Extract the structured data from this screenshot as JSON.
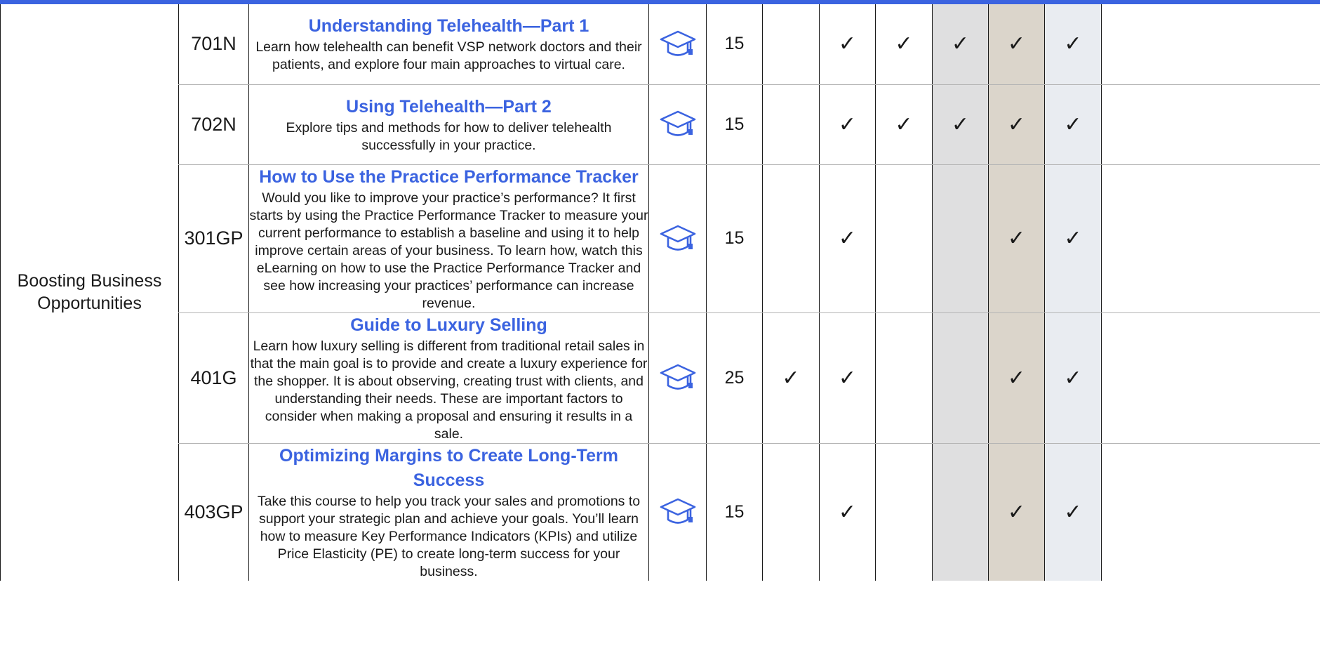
{
  "category": "Boosting Business Opportunities",
  "courses": [
    {
      "code": "701N",
      "title": "Understanding Telehealth—Part 1",
      "description": "Learn how telehealth can benefit VSP network doctors and their patients, and explore four main approaches to virtual care.",
      "icon": "graduation-cap-icon",
      "hours": "15",
      "checks": [
        "",
        "✓",
        "✓",
        "✓",
        "✓",
        "✓"
      ]
    },
    {
      "code": "702N",
      "title": "Using Telehealth—Part 2",
      "description": "Explore tips and methods for how to deliver telehealth successfully in your practice.",
      "icon": "graduation-cap-icon",
      "hours": "15",
      "checks": [
        "",
        "✓",
        "✓",
        "✓",
        "✓",
        "✓"
      ]
    },
    {
      "code": "301GP",
      "title": "How to Use the Practice Performance Tracker",
      "description": "Would you like to improve your practice’s performance? It first starts by using the Practice Performance Tracker to measure your current performance to establish a baseline and using it to help improve certain areas of your business. To learn how, watch this eLearning on how to use the Practice Performance Tracker and see how increasing your practices’ performance can increase revenue.",
      "icon": "graduation-cap-icon",
      "hours": "15",
      "checks": [
        "",
        "✓",
        "",
        "",
        "✓",
        "✓"
      ]
    },
    {
      "code": "401G",
      "title": "Guide to Luxury Selling",
      "description": "Learn how luxury selling is different from traditional retail sales in that the main goal is to provide and create a luxury experience for the shopper. It is about observing, creating trust with clients, and understanding their needs. These are important factors to consider when making a proposal and ensuring it results in a sale.",
      "icon": "graduation-cap-icon",
      "hours": "25",
      "checks": [
        "✓",
        "✓",
        "",
        "",
        "✓",
        "✓"
      ]
    },
    {
      "code": "403GP",
      "title": "Optimizing Margins to Create Long-Term Success",
      "description": "Take this course to help you track your sales and promotions to support your strategic plan and achieve your goals. You’ll learn how to measure Key Performance Indicators (KPIs) and utilize Price Elasticity (PE) to create long-term success for your business.",
      "icon": "graduation-cap-icon",
      "hours": "15",
      "checks": [
        "",
        "✓",
        "",
        "",
        "✓",
        "✓"
      ]
    }
  ],
  "colors": {
    "accent": "#3b63e0",
    "shade_gray": "#dfdfe0",
    "shade_tan": "#dbd5cb",
    "shade_blue": "#e9ecf1"
  }
}
